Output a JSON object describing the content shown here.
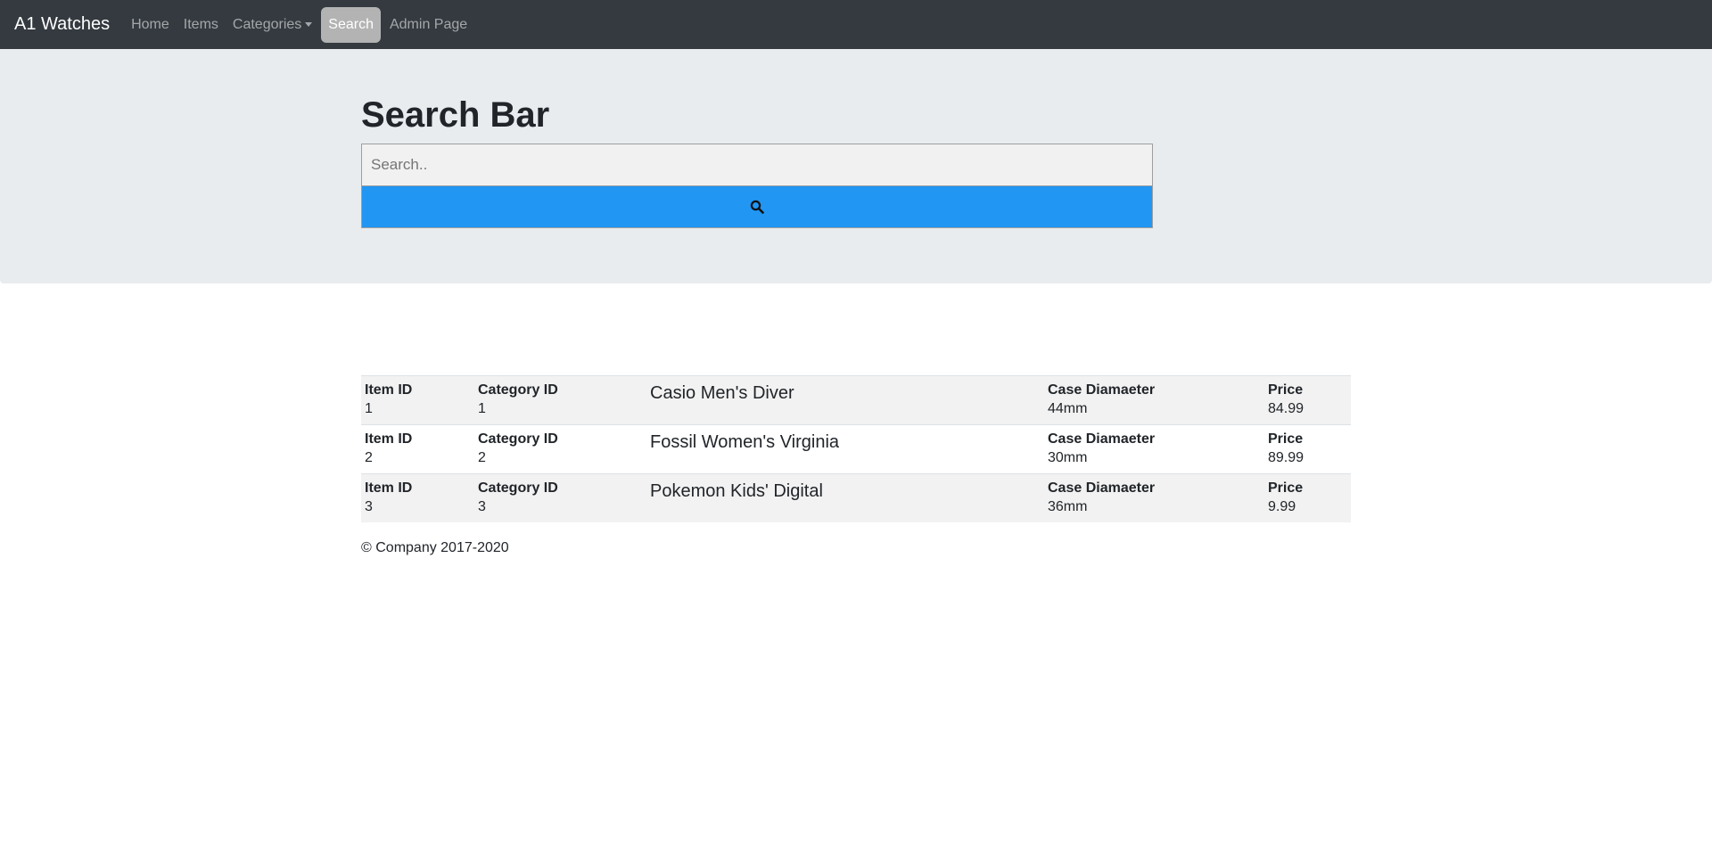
{
  "nav": {
    "brand": "A1 Watches",
    "items": [
      {
        "label": "Home"
      },
      {
        "label": "Items"
      },
      {
        "label": "Categories"
      },
      {
        "label": "Search"
      },
      {
        "label": "Admin Page"
      }
    ]
  },
  "search": {
    "title": "Search Bar",
    "placeholder": "Search..",
    "icon": "search-icon"
  },
  "results": {
    "labels": {
      "item_id": "Item ID",
      "category_id": "Category ID",
      "case_diameter": "Case Diamaeter",
      "price": "Price"
    },
    "rows": [
      {
        "item_id": "1",
        "category_id": "1",
        "name": "Casio Men's Diver",
        "case_diameter": "44mm",
        "price": "84.99"
      },
      {
        "item_id": "2",
        "category_id": "2",
        "name": "Fossil Women's Virginia",
        "case_diameter": "30mm",
        "price": "89.99"
      },
      {
        "item_id": "3",
        "category_id": "3",
        "name": "Pokemon Kids' Digital",
        "case_diameter": "36mm",
        "price": "9.99"
      }
    ]
  },
  "footer": {
    "text": "© Company 2017-2020"
  },
  "colors": {
    "navbar": "#343a40",
    "jumbotron": "#e9ecef",
    "search_button": "#2196F3",
    "active_nav": "#b3b3b3"
  }
}
